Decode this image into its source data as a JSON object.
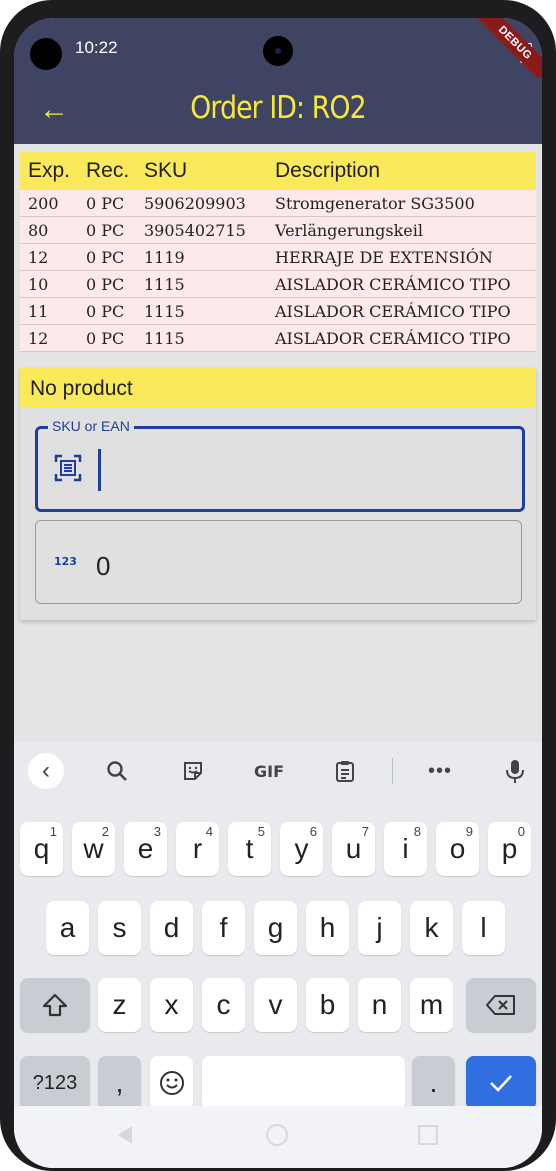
{
  "status_bar": {
    "time": "10:22"
  },
  "debug_banner": "DEBUG",
  "app_bar": {
    "title": "Order ID: RO2"
  },
  "table": {
    "headers": [
      "Exp.",
      "Rec.",
      "SKU",
      "Description"
    ],
    "rows": [
      [
        "200",
        "0 PC",
        "5906209903",
        "Stromgenerator SG3500"
      ],
      [
        "80",
        "0 PC",
        "3905402715",
        "Verlängerungskeil"
      ],
      [
        "12",
        "0 PC",
        "1119",
        "HERRAJE DE EXTENSIÓN"
      ],
      [
        "10",
        "0 PC",
        "1115",
        "AISLADOR CERÁMICO TIPO"
      ],
      [
        "11",
        "0 PC",
        "1115",
        "AISLADOR CERÁMICO TIPO"
      ],
      [
        "12",
        "0 PC",
        "1115",
        "AISLADOR CERÁMICO TIPO"
      ]
    ]
  },
  "product_panel": {
    "heading": "No product",
    "sku_field": {
      "label": "SKU or EAN",
      "value": ""
    },
    "qty_field": {
      "icon_text": "123",
      "value": "0"
    }
  },
  "keyboard": {
    "toolbar": {
      "gif": "GIF"
    },
    "row1": [
      {
        "k": "q",
        "s": "1"
      },
      {
        "k": "w",
        "s": "2"
      },
      {
        "k": "e",
        "s": "3"
      },
      {
        "k": "r",
        "s": "4"
      },
      {
        "k": "t",
        "s": "5"
      },
      {
        "k": "y",
        "s": "6"
      },
      {
        "k": "u",
        "s": "7"
      },
      {
        "k": "i",
        "s": "8"
      },
      {
        "k": "o",
        "s": "9"
      },
      {
        "k": "p",
        "s": "0"
      }
    ],
    "row2": [
      "a",
      "s",
      "d",
      "f",
      "g",
      "h",
      "j",
      "k",
      "l"
    ],
    "row3": [
      "z",
      "x",
      "c",
      "v",
      "b",
      "n",
      "m"
    ],
    "row4": {
      "symbols": "?123",
      "comma": ",",
      "period": "."
    }
  },
  "colors": {
    "appbar": "#3e4462",
    "accent_yellow": "#f5ea3c",
    "header_yellow": "#fbe95c",
    "row_pink": "#fde9e9",
    "field_blue": "#1f3e9c",
    "keyboard_blue": "#2f6fe0"
  }
}
